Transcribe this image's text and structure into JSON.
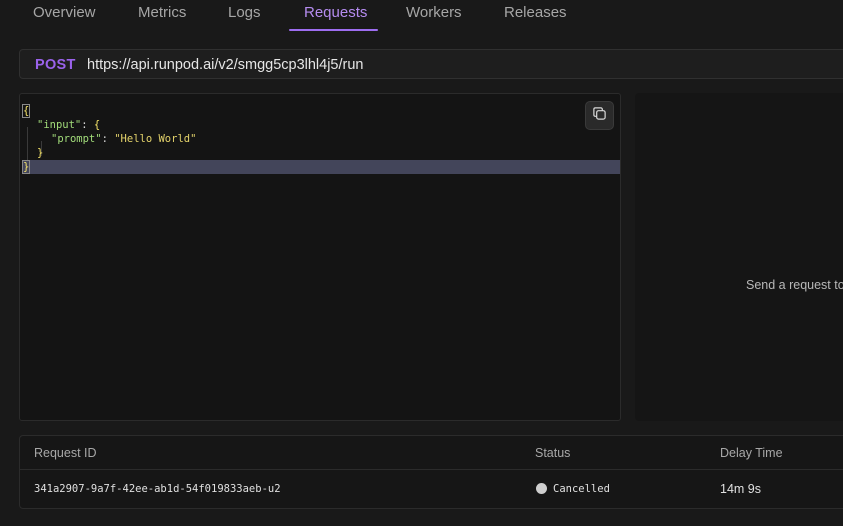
{
  "tabs": [
    {
      "label": "Overview"
    },
    {
      "label": "Metrics"
    },
    {
      "label": "Logs"
    },
    {
      "label": "Requests",
      "active": true
    },
    {
      "label": "Workers"
    },
    {
      "label": "Releases"
    }
  ],
  "request": {
    "method": "POST",
    "url": "https://api.runpod.ai/v2/smgg5cp3lhl4j5/run"
  },
  "editor": {
    "lines": [
      "{",
      "  \"input\": {",
      "    \"prompt\": \"Hello World\"",
      "  }",
      "}"
    ],
    "copy_icon": "copy-icon"
  },
  "response_panel": {
    "message": "Send a request to"
  },
  "table": {
    "headers": [
      "Request ID",
      "Status",
      "Delay Time"
    ],
    "rows": [
      {
        "request_id": "341a2907-9a7f-42ee-ab1d-54f019833aeb-u2",
        "status": "Cancelled",
        "delay_time": "14m 9s"
      }
    ]
  },
  "colors": {
    "accent": "#9d6df0",
    "method": "#9a62eb",
    "background": "#191919"
  }
}
